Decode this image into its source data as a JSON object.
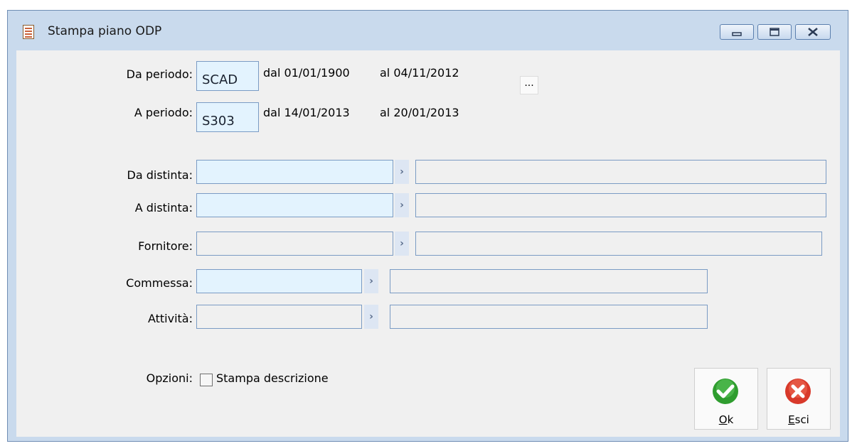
{
  "window": {
    "title": "Stampa piano ODP"
  },
  "period_from": {
    "label": "Da periodo:",
    "code": "SCAD",
    "dal": "dal 01/01/1900",
    "al": "al 04/11/2012",
    "ellipsis": "..."
  },
  "period_to": {
    "label": "A periodo:",
    "code": "S303",
    "dal": "dal 14/01/2013",
    "al": "al 20/01/2013"
  },
  "fields": {
    "da_distinta": {
      "label": "Da distinta:",
      "value": "",
      "description": ""
    },
    "a_distinta": {
      "label": "A distinta:",
      "value": "",
      "description": ""
    },
    "fornitore": {
      "label": "Fornitore:",
      "value": "",
      "description": ""
    },
    "commessa": {
      "label": "Commessa:",
      "value": "",
      "description": ""
    },
    "attivita": {
      "label": "Attività:",
      "value": "",
      "description": ""
    }
  },
  "options": {
    "label": "Opzioni:",
    "stampa_descrizione": {
      "label": "Stampa descrizione",
      "checked": false
    }
  },
  "buttons": {
    "ok": {
      "mnemonic": "O",
      "rest": "k"
    },
    "esci": {
      "mnemonic": "E",
      "rest": "sci"
    }
  },
  "colors": {
    "frame": "#c9daed",
    "client": "#f0f0f0",
    "field_highlight": "#e3f3fe",
    "ok_green": "#2f9d2f",
    "esci_red": "#d8392a"
  },
  "icons": [
    "app-icon",
    "minimize-icon",
    "maximize-icon",
    "close-icon",
    "chevron-right-icon",
    "checkmark-icon",
    "x-icon"
  ]
}
